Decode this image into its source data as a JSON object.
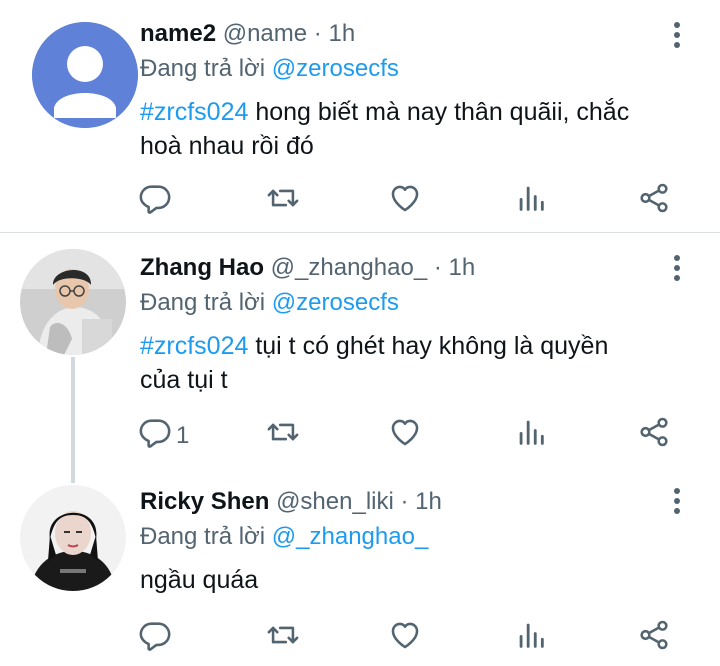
{
  "tweets": [
    {
      "display_name": "name2",
      "handle": "@name",
      "separator": "·",
      "time": "1h",
      "reply_prefix": "Đang trả lời",
      "reply_to": "@zerosecfs",
      "hashtag": "#zrcfs024",
      "text_line1": " hong biết mà nay thân quãii, chắc",
      "text_line2": "hoà nhau rồi đó",
      "reply_count": ""
    },
    {
      "display_name": "Zhang Hao",
      "handle": "@_zhanghao_",
      "separator": "·",
      "time": "1h",
      "reply_prefix": "Đang trả lời",
      "reply_to": "@zerosecfs",
      "hashtag": "#zrcfs024",
      "text_line1": " tụi t có ghét hay không là quyền",
      "text_line2": "của tụi t",
      "reply_count": "1"
    },
    {
      "display_name": "Ricky Shen",
      "handle": "@shen_liki",
      "separator": "·",
      "time": "1h",
      "reply_prefix": "Đang trả lời",
      "reply_to": "@_zhanghao_",
      "text_line1": "ngầu quáa",
      "reply_count": ""
    }
  ],
  "icons": {
    "reply": "reply-icon",
    "retweet": "retweet-icon",
    "like": "heart-icon",
    "analytics": "analytics-icon",
    "share": "share-icon",
    "more": "more-vertical-icon"
  },
  "colors": {
    "accent": "#1d9bf0",
    "muted": "#536471",
    "text": "#0f1419"
  }
}
